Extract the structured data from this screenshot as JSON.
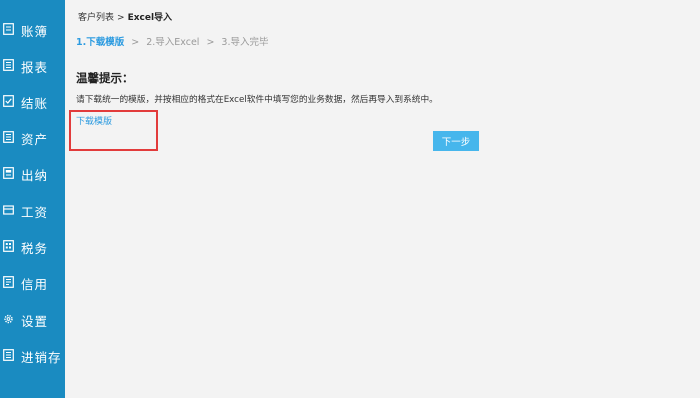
{
  "sidebar": {
    "items": [
      {
        "label": "账簿",
        "icon": "ledger-icon"
      },
      {
        "label": "报表",
        "icon": "report-icon"
      },
      {
        "label": "结账",
        "icon": "checkout-icon"
      },
      {
        "label": "资产",
        "icon": "asset-icon"
      },
      {
        "label": "出纳",
        "icon": "cashier-icon"
      },
      {
        "label": "工资",
        "icon": "salary-icon"
      },
      {
        "label": "税务",
        "icon": "tax-icon"
      },
      {
        "label": "信用",
        "icon": "credit-icon"
      },
      {
        "label": "设置",
        "icon": "gear-icon"
      },
      {
        "label": "进销存",
        "icon": "inventory-icon"
      }
    ]
  },
  "breadcrumb": {
    "parent": "客户列表",
    "separator": ">",
    "current": "Excel导入"
  },
  "steps": {
    "items": [
      "1.下载模版",
      "2.导入Excel",
      "3.导入完毕"
    ],
    "active_index": 0,
    "arrow": ">"
  },
  "tips": {
    "title": "温馨提示：",
    "text": "请下载统一的模版，并按相应的格式在Excel软件中填写您的业务数据，然后再导入到系统中。"
  },
  "download_link": "下载模版",
  "next_button": "下一步",
  "colors": {
    "sidebar": "#1a8bc1",
    "accent": "#2c9be0",
    "button": "#46b6ec",
    "highlight": "#e23b3b",
    "background": "#f3f3f3"
  }
}
